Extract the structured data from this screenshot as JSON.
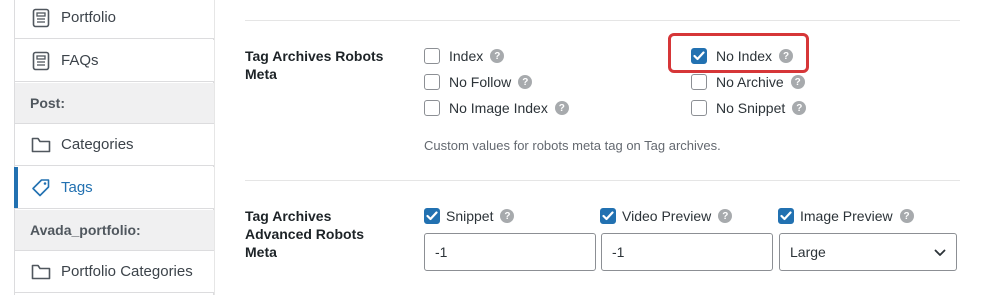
{
  "sidebar": {
    "items": [
      {
        "label": "Portfolio",
        "icon": "document-icon"
      },
      {
        "label": "FAQs",
        "icon": "document-icon"
      }
    ],
    "groups": [
      {
        "label": "Post:"
      },
      {
        "label": "Avada_portfolio:"
      }
    ],
    "post_items": [
      {
        "label": "Categories",
        "icon": "folder-icon"
      },
      {
        "label": "Tags",
        "icon": "tag-icon",
        "active": true
      }
    ],
    "portfolio_items": [
      {
        "label": "Portfolio Categories",
        "icon": "folder-icon"
      }
    ]
  },
  "robots_meta": {
    "label": "Tag Archives Robots Meta",
    "options": [
      {
        "label": "Index",
        "checked": false
      },
      {
        "label": "No Index",
        "checked": true,
        "highlighted": true
      },
      {
        "label": "No Follow",
        "checked": false
      },
      {
        "label": "No Archive",
        "checked": false
      },
      {
        "label": "No Image Index",
        "checked": false
      },
      {
        "label": "No Snippet",
        "checked": false
      }
    ],
    "description": "Custom values for robots meta tag on Tag archives."
  },
  "advanced_robots_meta": {
    "label": "Tag Archives Advanced Robots Meta",
    "snippet": {
      "label": "Snippet",
      "checked": true,
      "value": "-1"
    },
    "video_preview": {
      "label": "Video Preview",
      "checked": true,
      "value": "-1"
    },
    "image_preview": {
      "label": "Image Preview",
      "checked": true,
      "value": "Large"
    }
  },
  "colors": {
    "accent": "#2271b1",
    "highlight_border": "#d63638",
    "help_icon": "#a7aaad"
  }
}
